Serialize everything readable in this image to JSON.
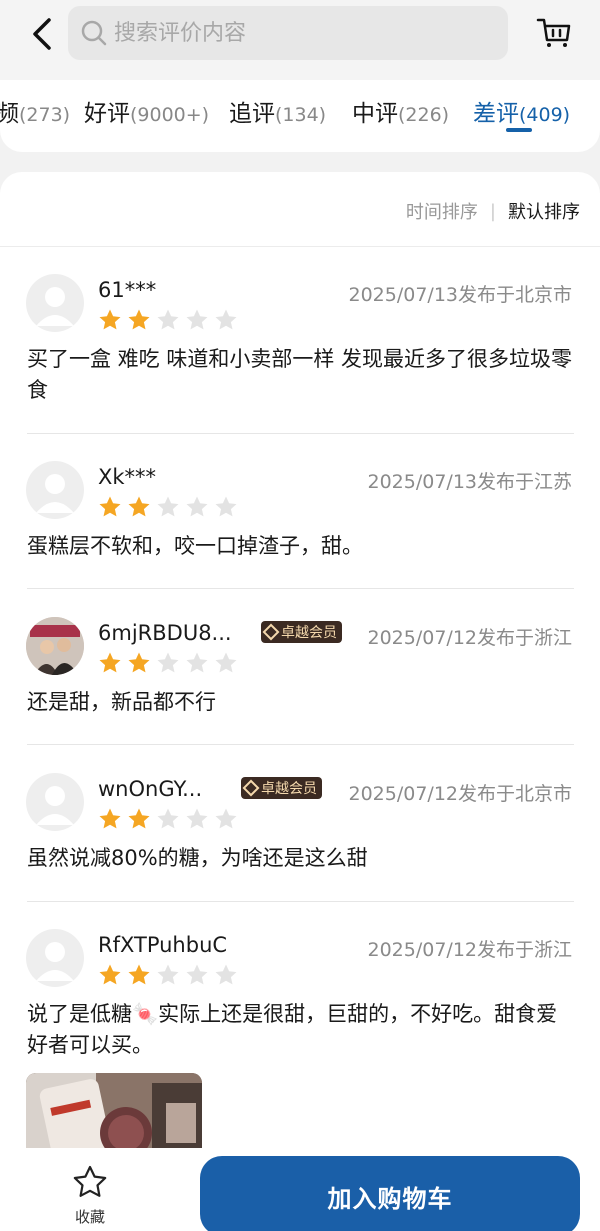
{
  "search": {
    "placeholder": "搜索评价内容"
  },
  "icons": {
    "back": "chevron-left-icon",
    "search": "search-icon",
    "cart": "cart-icon",
    "favorite": "star-outline-icon"
  },
  "tabs": [
    {
      "label": "频",
      "count": "(273)"
    },
    {
      "label": "好评",
      "count": "(9000+)"
    },
    {
      "label": "追评",
      "count": "(134)"
    },
    {
      "label": "中评",
      "count": "(226)"
    },
    {
      "label": "差评",
      "count": "(409)",
      "active": true
    }
  ],
  "sort": {
    "time": "时间排序",
    "separator": "|",
    "default": "默认排序"
  },
  "badge_label": "卓越会员",
  "reviews": [
    {
      "user": "61***",
      "date": "2025/07/13发布于北京市",
      "rating": 2,
      "text": "买了一盒 难吃 味道和小卖部一样 发现最近多了很多垃圾零食"
    },
    {
      "user": "Xk***",
      "date": "2025/07/13发布于江苏",
      "rating": 2,
      "text": "蛋糕层不软和，咬一口掉渣子，甜。"
    },
    {
      "user": "6mjRBDU8...",
      "date": "2025/07/12发布于浙江",
      "rating": 2,
      "text": "还是甜，新品都不行",
      "member": true
    },
    {
      "user": "wnOnGY...",
      "date": "2025/07/12发布于北京市",
      "rating": 2,
      "text": "虽然说减80%的糖，为啥还是这么甜",
      "member": true
    },
    {
      "user": "RfXTPuhbuC",
      "date": "2025/07/12发布于浙江",
      "rating": 2,
      "text": "说了是低糖🍬实际上还是很甜，巨甜的，不好吃。甜食爱好者可以买。"
    }
  ],
  "bottom": {
    "favorite_label": "收藏",
    "add_to_cart_label": "加入购物车"
  },
  "colors": {
    "accent": "#1561a9",
    "star": "#f5a623",
    "star_empty": "#e3e3e3",
    "badge_bg": "#3b2a22",
    "badge_text": "#f4d8ac"
  }
}
